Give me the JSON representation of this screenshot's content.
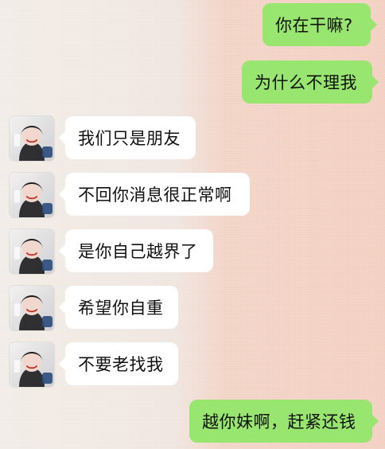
{
  "chat": {
    "messages": [
      {
        "side": "right",
        "text": "你在干嘛?"
      },
      {
        "side": "right",
        "text": "为什么不理我"
      },
      {
        "side": "left",
        "text": "我们只是朋友"
      },
      {
        "side": "left",
        "text": "不回你消息很正常啊"
      },
      {
        "side": "left",
        "text": "是你自己越界了"
      },
      {
        "side": "left",
        "text": "希望你自重"
      },
      {
        "side": "left",
        "text": "不要老找我"
      },
      {
        "side": "right",
        "text": "越你妹啊，赶紧还钱"
      }
    ]
  },
  "colors": {
    "right_bubble": "#98e66f",
    "left_bubble": "#ffffff",
    "text": "#111111"
  },
  "icons": {
    "avatar": "avatar-icon"
  }
}
